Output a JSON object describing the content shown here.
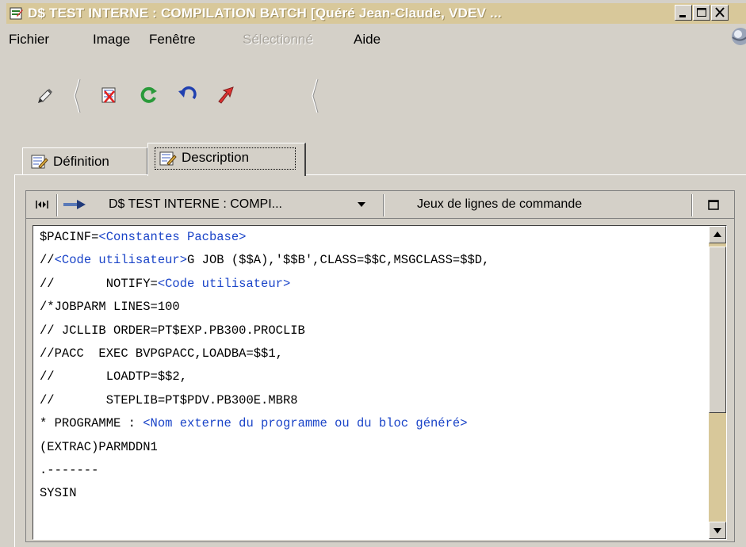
{
  "window": {
    "title": "D$ TEST INTERNE : COMPILATION BATCH [Quéré Jean-Claude, VDEV ..."
  },
  "menu": [
    "Fichier",
    "Image",
    "Fenêtre",
    "Sélectionné",
    "Aide"
  ],
  "menu_disabled": [
    "Sélectionné"
  ],
  "toolbar": {
    "icons": [
      "pencil-icon",
      "delete-icon",
      "refresh-icon",
      "undo-icon",
      "arrow-icon"
    ]
  },
  "tabs": [
    {
      "label": "Définition",
      "active": false
    },
    {
      "label": "Description",
      "active": true
    }
  ],
  "pane": {
    "entity_label": "D$ TEST INTERNE : COMPI...",
    "section_label": "Jeux de lignes de commande"
  },
  "code_lines": [
    [
      [
        "t",
        "$PACINF="
      ],
      [
        "m",
        "<Constantes Pacbase>"
      ]
    ],
    [
      [
        "t",
        "//"
      ],
      [
        "m",
        "<Code utilisateur>"
      ],
      [
        "t",
        "G JOB ($$A),'$$B',CLASS=$$C,MSGCLASS=$$D,"
      ]
    ],
    [
      [
        "t",
        "//       NOTIFY="
      ],
      [
        "m",
        "<Code utilisateur>"
      ]
    ],
    [
      [
        "t",
        "/*JOBPARM LINES=100"
      ]
    ],
    [
      [
        "t",
        "// JCLLIB ORDER=PT$EXP.PB300.PROCLIB"
      ]
    ],
    [
      [
        "t",
        "//PACC  EXEC BVPGPACC,LOADBA=$$1,"
      ]
    ],
    [
      [
        "t",
        "//       LOADTP=$$2,"
      ]
    ],
    [
      [
        "t",
        "//       STEPLIB=PT$PDV.PB300E.MBR8"
      ]
    ],
    [
      [
        "t",
        "* PROGRAMME : "
      ],
      [
        "m",
        "<Nom externe du programme ou du bloc généré>"
      ]
    ],
    [
      [
        "t",
        "(EXTRAC)PARMDDN1"
      ]
    ],
    [
      [
        "t",
        ".-------"
      ]
    ],
    [
      [
        "t",
        "SYSIN"
      ]
    ]
  ],
  "colors": {
    "titlebar": "#d8c89a",
    "macro_text": "#1a44c8",
    "scroll_track": "#d8c89a"
  }
}
